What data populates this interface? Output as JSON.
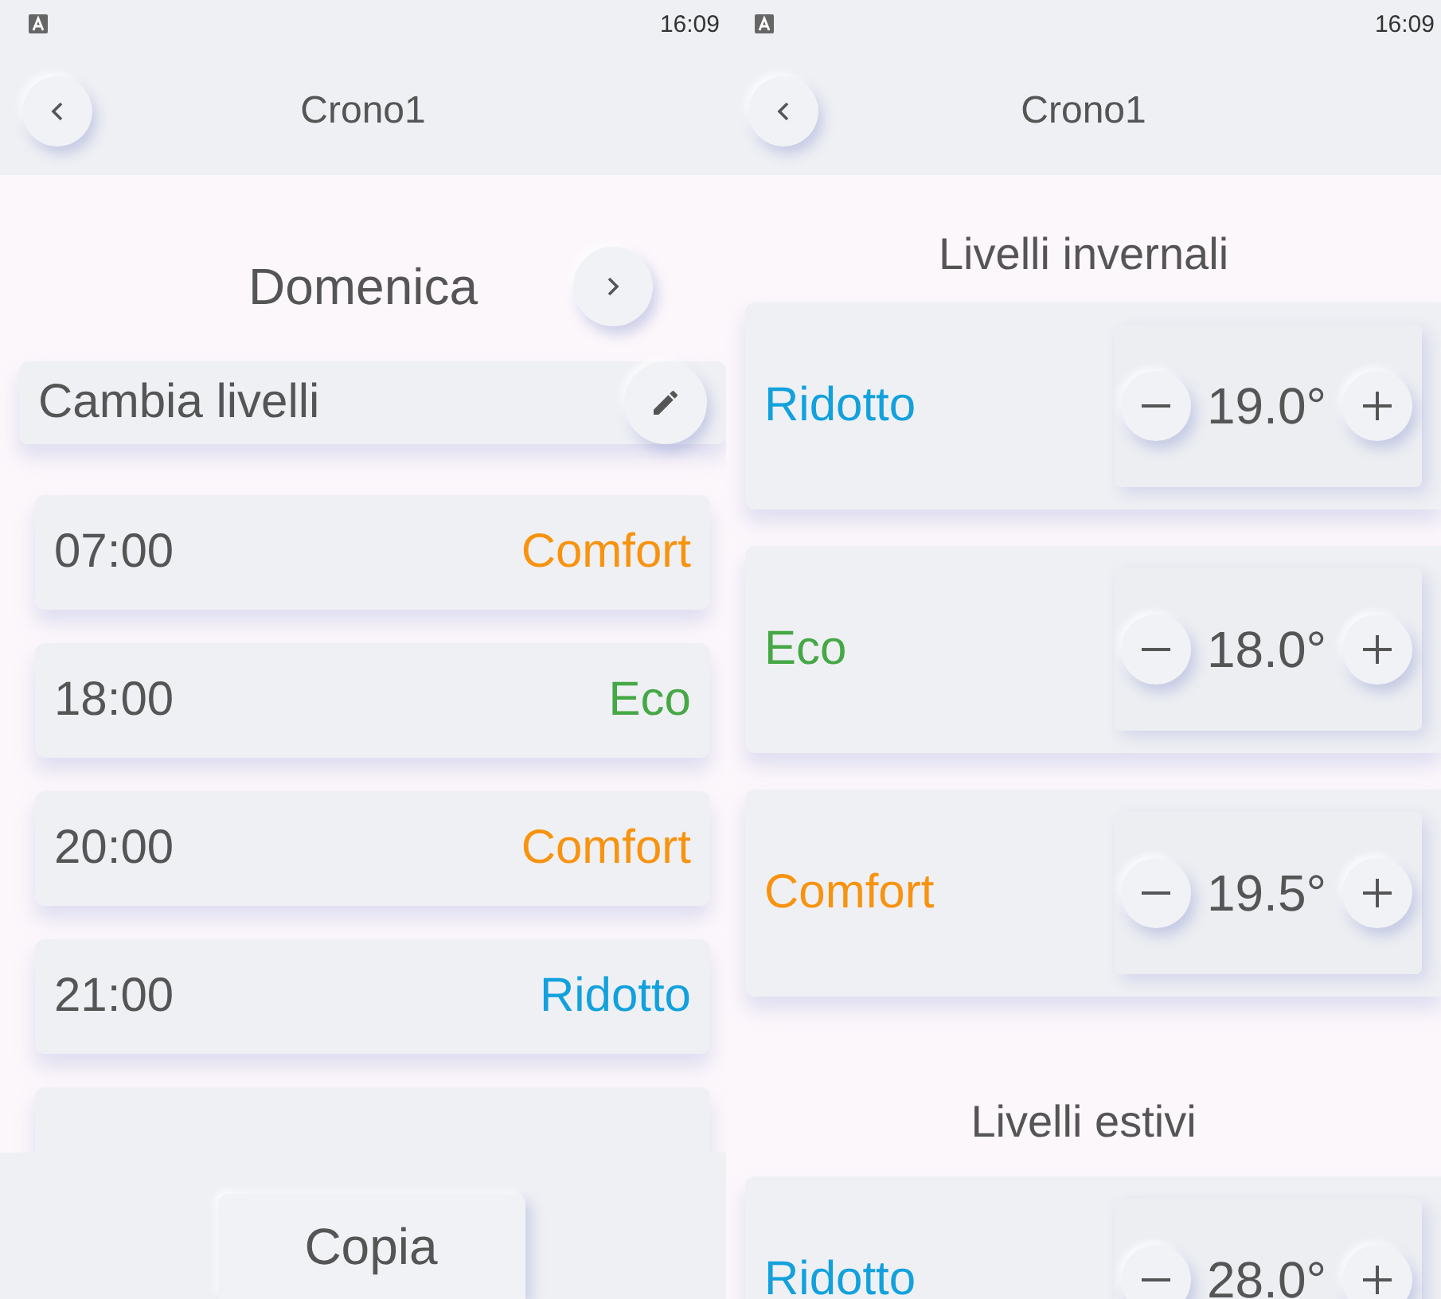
{
  "left_screen": {
    "status_bar": {
      "time": "16:09"
    },
    "header": {
      "title": "Crono1"
    },
    "day": {
      "label": "Domenica"
    },
    "change_levels": {
      "label": "Cambia livelli"
    },
    "schedule": [
      {
        "time": "07:00",
        "mode": "Comfort",
        "color": "#f7930f"
      },
      {
        "time": "18:00",
        "mode": "Eco",
        "color": "#45a845"
      },
      {
        "time": "20:00",
        "mode": "Comfort",
        "color": "#f7930f"
      },
      {
        "time": "21:00",
        "mode": "Ridotto",
        "color": "#12a1dc"
      }
    ],
    "footer": {
      "button": "Copia"
    }
  },
  "right_screen": {
    "status_bar": {
      "time": "16:09"
    },
    "header": {
      "title": "Crono1"
    },
    "sections": [
      {
        "title": "Livelli invernali",
        "levels": [
          {
            "name": "Ridotto",
            "value": "19.0°",
            "color": "#12a1dc"
          },
          {
            "name": "Eco",
            "value": "18.0°",
            "color": "#45a845"
          },
          {
            "name": "Comfort",
            "value": "19.5°",
            "color": "#f7930f"
          }
        ]
      },
      {
        "title": "Livelli estivi",
        "levels": [
          {
            "name": "Ridotto",
            "value": "28.0°",
            "color": "#12a1dc"
          }
        ]
      }
    ]
  }
}
